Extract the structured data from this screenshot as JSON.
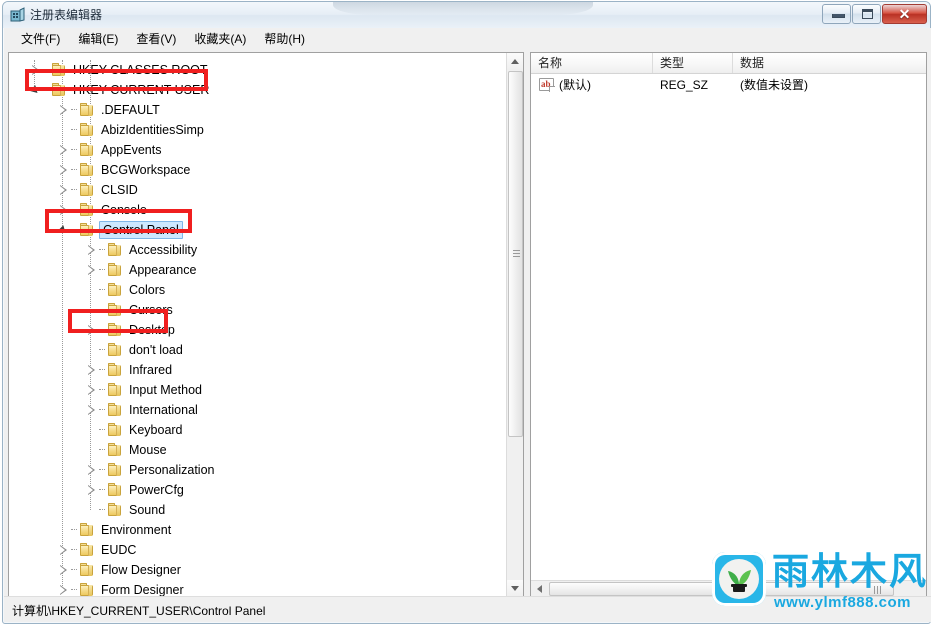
{
  "window": {
    "title": "注册表编辑器",
    "icon": "regedit-icon",
    "controls": {
      "minimize": "最小化",
      "maximize": "最大化",
      "close": "✕"
    }
  },
  "menu": {
    "items": [
      {
        "label": "文件(F)"
      },
      {
        "label": "编辑(E)"
      },
      {
        "label": "查看(V)"
      },
      {
        "label": "收藏夹(A)"
      },
      {
        "label": "帮助(H)"
      }
    ]
  },
  "tree": {
    "nodes": [
      {
        "label": "HKEY CLASSES ROOT",
        "depth": 1,
        "state": "collapsed",
        "selected": false,
        "highlighted": false
      },
      {
        "label": "HKEY CURRENT USER",
        "depth": 1,
        "state": "expanded",
        "selected": false,
        "highlighted": true
      },
      {
        "label": ".DEFAULT",
        "depth": 2,
        "state": "collapsed",
        "selected": false,
        "highlighted": false
      },
      {
        "label": "AbizIdentitiesSimp",
        "depth": 2,
        "state": "leaf",
        "selected": false,
        "highlighted": false
      },
      {
        "label": "AppEvents",
        "depth": 2,
        "state": "collapsed",
        "selected": false,
        "highlighted": false
      },
      {
        "label": "BCGWorkspace",
        "depth": 2,
        "state": "collapsed",
        "selected": false,
        "highlighted": false
      },
      {
        "label": "CLSID",
        "depth": 2,
        "state": "collapsed",
        "selected": false,
        "highlighted": false
      },
      {
        "label": "Console",
        "depth": 2,
        "state": "collapsed",
        "selected": false,
        "highlighted": false
      },
      {
        "label": "Control Panel",
        "depth": 2,
        "state": "expanded",
        "selected": true,
        "highlighted": true
      },
      {
        "label": "Accessibility",
        "depth": 3,
        "state": "collapsed",
        "selected": false,
        "highlighted": false
      },
      {
        "label": "Appearance",
        "depth": 3,
        "state": "collapsed",
        "selected": false,
        "highlighted": false
      },
      {
        "label": "Colors",
        "depth": 3,
        "state": "leaf",
        "selected": false,
        "highlighted": false
      },
      {
        "label": "Cursors",
        "depth": 3,
        "state": "leaf",
        "selected": false,
        "highlighted": false
      },
      {
        "label": "Desktop",
        "depth": 3,
        "state": "collapsed",
        "selected": false,
        "highlighted": true
      },
      {
        "label": "don't load",
        "depth": 3,
        "state": "leaf",
        "selected": false,
        "highlighted": false
      },
      {
        "label": "Infrared",
        "depth": 3,
        "state": "collapsed",
        "selected": false,
        "highlighted": false
      },
      {
        "label": "Input Method",
        "depth": 3,
        "state": "collapsed",
        "selected": false,
        "highlighted": false
      },
      {
        "label": "International",
        "depth": 3,
        "state": "collapsed",
        "selected": false,
        "highlighted": false
      },
      {
        "label": "Keyboard",
        "depth": 3,
        "state": "leaf",
        "selected": false,
        "highlighted": false
      },
      {
        "label": "Mouse",
        "depth": 3,
        "state": "leaf",
        "selected": false,
        "highlighted": false
      },
      {
        "label": "Personalization",
        "depth": 3,
        "state": "collapsed",
        "selected": false,
        "highlighted": false
      },
      {
        "label": "PowerCfg",
        "depth": 3,
        "state": "collapsed",
        "selected": false,
        "highlighted": false
      },
      {
        "label": "Sound",
        "depth": 3,
        "state": "leaf",
        "selected": false,
        "highlighted": false
      },
      {
        "label": "Environment",
        "depth": 2,
        "state": "leaf",
        "selected": false,
        "highlighted": false
      },
      {
        "label": "EUDC",
        "depth": 2,
        "state": "collapsed",
        "selected": false,
        "highlighted": false
      },
      {
        "label": "Flow Designer",
        "depth": 2,
        "state": "collapsed",
        "selected": false,
        "highlighted": false
      },
      {
        "label": "Form Designer",
        "depth": 2,
        "state": "collapsed",
        "selected": false,
        "highlighted": false
      }
    ]
  },
  "list": {
    "columns": [
      {
        "label": "名称"
      },
      {
        "label": "类型"
      },
      {
        "label": "数据"
      }
    ],
    "rows": [
      {
        "icon": "string-value-icon",
        "name": "(默认)",
        "type": "REG_SZ",
        "data": "(数值未设置)"
      }
    ]
  },
  "statusbar": {
    "path": "计算机\\HKEY_CURRENT_USER\\Control Panel"
  },
  "watermark": {
    "brand": "雨林木风",
    "url": "www.ylmf888.com",
    "color": "#1aa8e0"
  },
  "annotations": {
    "color": "#f01f1f",
    "boxes": [
      {
        "target": "HKEY CURRENT USER"
      },
      {
        "target": "Control Panel"
      },
      {
        "target": "Desktop"
      }
    ]
  },
  "scrollbars": {
    "tree_vertical": {
      "position": "top"
    },
    "list_horizontal": {
      "position": "left"
    }
  }
}
